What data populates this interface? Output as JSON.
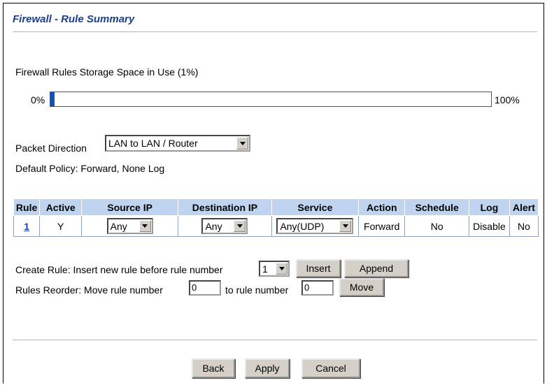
{
  "page_title": "Firewall - Rule Summary",
  "storage": {
    "label": "Firewall Rules Storage Space in Use  (1%)",
    "percent_used": 1,
    "min_label": "0%",
    "max_label": "100%"
  },
  "packet_direction": {
    "label": "Packet Direction",
    "selected": "LAN to LAN / Router"
  },
  "default_policy": "Default Policy: Forward, None Log",
  "rules_table": {
    "headers": [
      "Rule",
      "Active",
      "Source IP",
      "Destination IP",
      "Service",
      "Action",
      "Schedule",
      "Log",
      "Alert"
    ],
    "rows": [
      {
        "rule": "1",
        "active": "Y",
        "source_ip": "Any",
        "destination_ip": "Any",
        "service": "Any(UDP)",
        "action": "Forward",
        "schedule": "No",
        "log": "Disable",
        "alert": "No"
      }
    ]
  },
  "create_rule": {
    "label": "Create Rule: Insert new rule before rule number",
    "selected": "1",
    "insert_label": "Insert",
    "append_label": "Append"
  },
  "reorder": {
    "label": "Rules Reorder: Move rule number",
    "from_value": "0",
    "mid_label": "to rule number",
    "to_value": "0",
    "move_label": "Move"
  },
  "buttons": {
    "back": "Back",
    "apply": "Apply",
    "cancel": "Cancel"
  },
  "colors": {
    "title": "#1a3f8a",
    "header_bg": "#bfd4ee",
    "bar_fill": "#1255b8"
  }
}
